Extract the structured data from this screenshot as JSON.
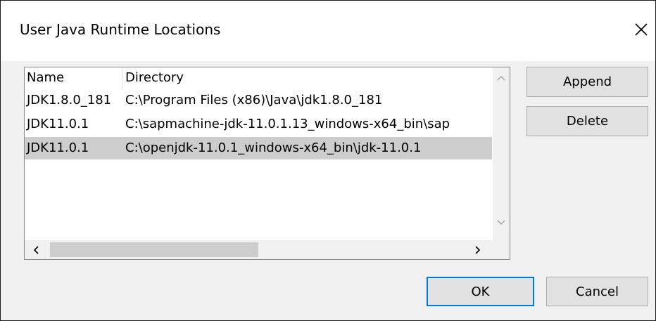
{
  "dialog": {
    "title": "User Java Runtime Locations"
  },
  "table": {
    "columns": [
      "Name",
      "Directory"
    ],
    "rows": [
      {
        "name": "JDK1.8.0_181",
        "directory": "C:\\Program Files (x86)\\Java\\jdk1.8.0_181"
      },
      {
        "name": "JDK11.0.1",
        "directory": "C:\\sapmachine-jdk-11.0.1.13_windows-x64_bin\\sap"
      },
      {
        "name": "JDK11.0.1",
        "directory": "C:\\openjdk-11.0.1_windows-x64_bin\\jdk-11.0.1"
      }
    ]
  },
  "buttons": {
    "append": "Append",
    "delete": "Delete",
    "ok": "OK",
    "cancel": "Cancel"
  },
  "icons": {
    "close": "close-icon",
    "scroll_up": "chevron-up-icon",
    "scroll_down": "chevron-down-icon",
    "scroll_left": "chevron-left-icon",
    "scroll_right": "chevron-right-icon"
  },
  "colors": {
    "selected_row": "#cdcdcd",
    "default_button_border": "#0078d7"
  }
}
